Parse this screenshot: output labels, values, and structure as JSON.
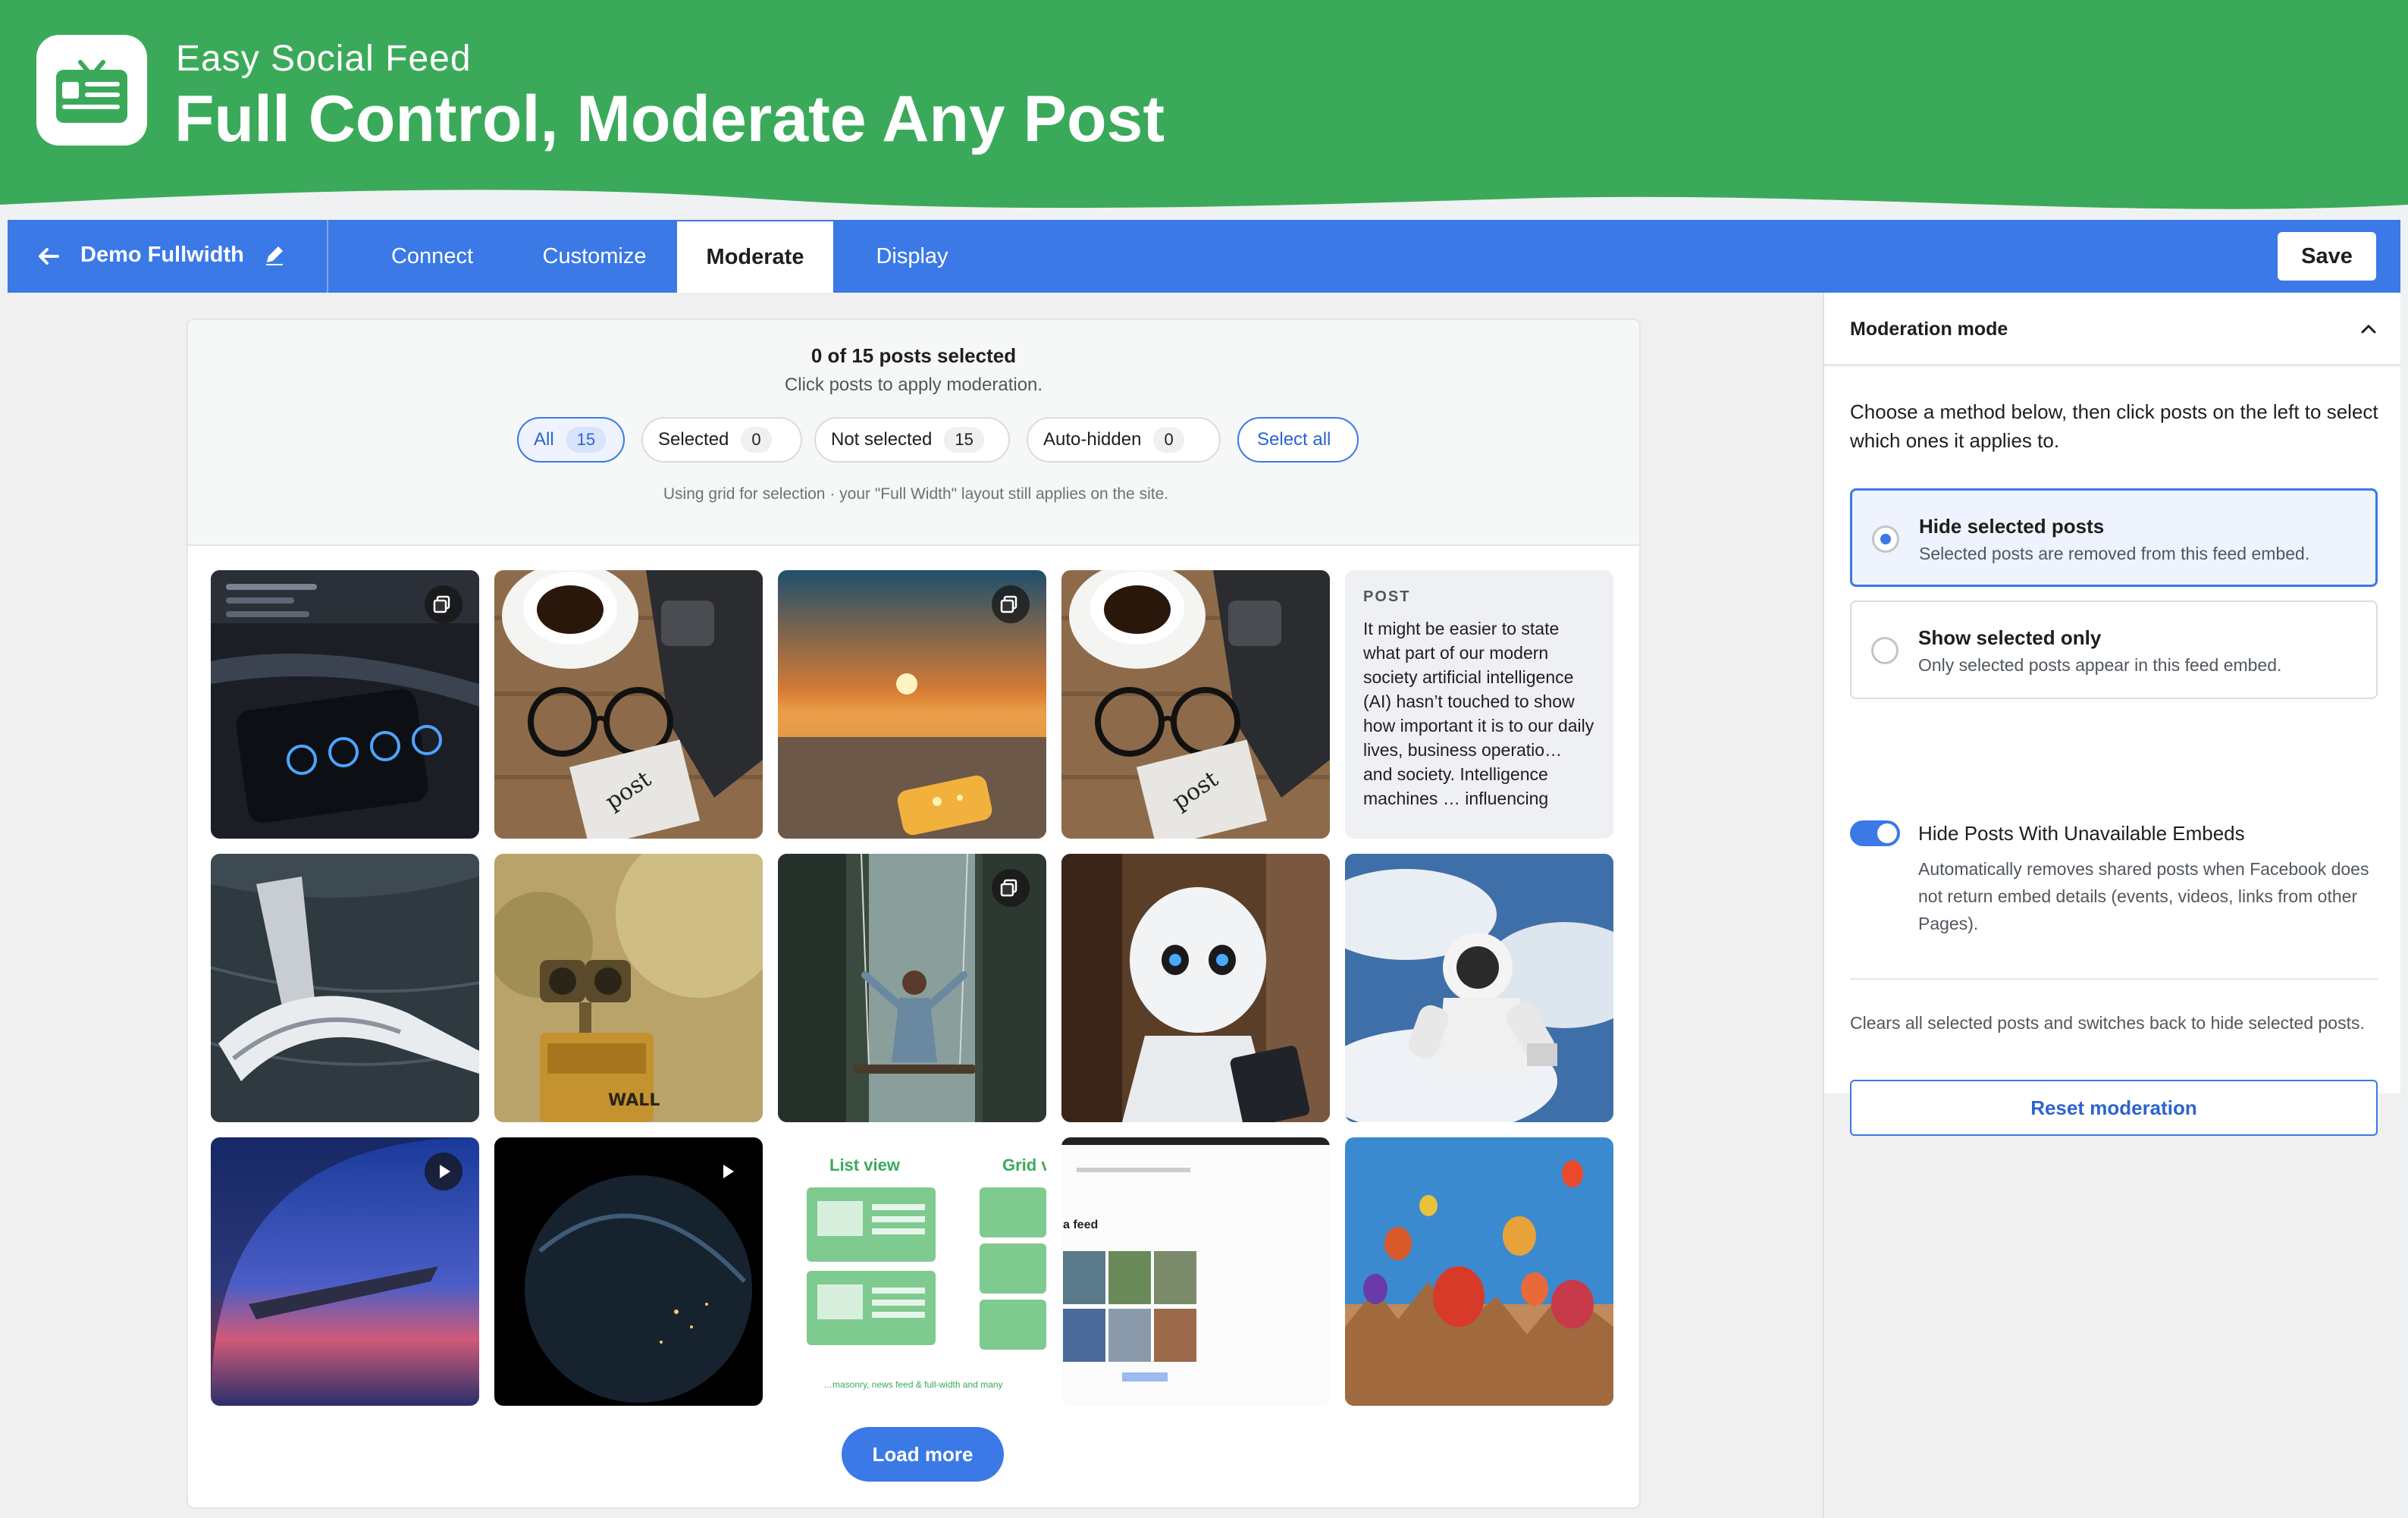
{
  "banner": {
    "brand": "Easy Social Feed",
    "headline": "Full Control, Moderate Any Post"
  },
  "topbar": {
    "feed_name": "Demo Fullwidth",
    "tabs": [
      "Connect",
      "Customize",
      "Moderate",
      "Display"
    ],
    "active_tab": "Moderate",
    "save_label": "Save"
  },
  "moderation": {
    "count_title": "0 of 15 posts selected",
    "count_sub": "Click posts to apply moderation.",
    "filters": [
      {
        "label": "All",
        "count": "15"
      },
      {
        "label": "Selected",
        "count": "0"
      },
      {
        "label": "Not selected",
        "count": "15"
      },
      {
        "label": "Auto-hidden",
        "count": "0"
      }
    ],
    "select_all": "Select all",
    "grid_note": "Using grid for selection · your \"Full Width\" layout still applies on the site.",
    "text_post": {
      "kind": "POST",
      "body": "It might be easier to state what part of our modern society artificial intelligence (AI) hasn’t touched to show how important it is to our daily lives, business operatio… and society. Intelligence machines … influencing"
    },
    "list_view_label": "List view",
    "grid_view_label": "Grid v",
    "list_view_caption": "…masonry, news feed & full-width and many",
    "feed_label": "a feed",
    "load_more": "Load more"
  },
  "sidebar": {
    "title": "Moderation mode",
    "intro": "Choose a method below, then click posts on the left to select which ones it applies to.",
    "options": [
      {
        "title": "Hide selected posts",
        "desc": "Selected posts are removed from this feed embed."
      },
      {
        "title": "Show selected only",
        "desc": "Only selected posts appear in this feed embed."
      }
    ],
    "toggle_label": "Hide Posts With Unavailable Embeds",
    "toggle_desc": "Automatically removes shared posts when Facebook does not return embed details (events, videos, links from other Pages).",
    "reset_desc": "Clears all selected posts and switches back to hide selected posts.",
    "reset_label": "Reset moderation"
  },
  "colors": {
    "brand_green": "#3aaa5a",
    "accent_blue": "#3a79e6"
  },
  "icons": [
    "tv-feed-logo-icon",
    "arrow-left-icon",
    "pencil-icon",
    "copy-icon",
    "play-icon",
    "chevron-up-icon"
  ]
}
